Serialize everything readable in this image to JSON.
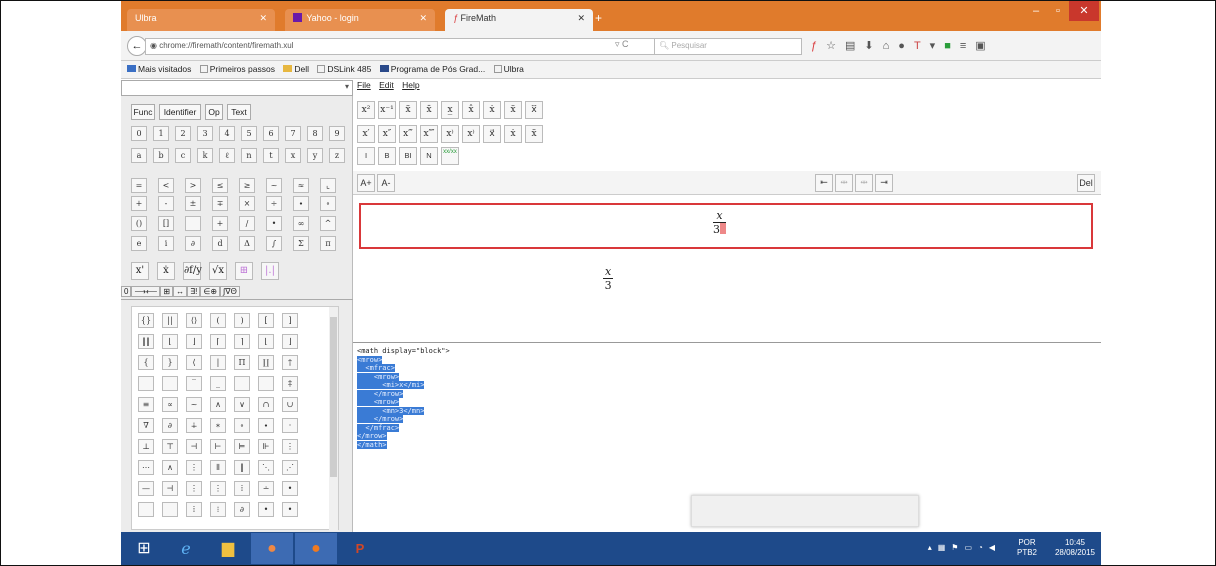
{
  "browser": {
    "tabs": [
      {
        "label": "Ulbra",
        "state": "inactive"
      },
      {
        "label": "Yahoo - login",
        "state": "inactive"
      },
      {
        "label": "FireMath",
        "state": "active"
      }
    ],
    "url": "chrome://firemath/content/firemath.xul",
    "search_placeholder": "Pesquisar",
    "bookmarks": [
      "Mais visitados",
      "Primeiros passos",
      "Dell",
      "DSLink 485",
      "Programa de Pós Grad...",
      "Ulbra"
    ],
    "accent_color": "#e07b2c"
  },
  "palette": {
    "type_buttons": [
      "Func",
      "Identifier",
      "Op",
      "Text"
    ],
    "digits": [
      "0",
      "1",
      "2",
      "3",
      "4",
      "5",
      "6",
      "7",
      "8",
      "9"
    ],
    "letters": [
      "a",
      "b",
      "c",
      "k",
      "ℓ",
      "n",
      "t",
      "x",
      "y",
      "z"
    ],
    "ops_row1": [
      "=",
      "<",
      ">",
      "≤",
      "≥",
      "~",
      "≈",
      "⌞"
    ],
    "ops_row2": [
      "+",
      "-",
      "±",
      "∓",
      "×",
      "÷",
      "∙",
      "∘"
    ],
    "ops_row3": [
      "()",
      "[]",
      "",
      "+",
      "/",
      "•",
      "∞",
      "^"
    ],
    "ops_row4": [
      "e",
      "i",
      "∂",
      "d",
      "Δ",
      "∫",
      "Σ",
      "π"
    ],
    "big_row": [
      "x'",
      "ẋ",
      "∂f/y",
      "√x",
      "⊞",
      "|.|"
    ],
    "sub_tabs": [
      "0",
      "⟶⟵",
      "⊞",
      "↔",
      "∃!",
      "∈⊕",
      "∫∇Θ"
    ],
    "symbols": [
      [
        "{}",
        "||",
        "⟨⟩",
        "(",
        ")",
        "[",
        "]"
      ],
      [
        "‖‖",
        "⌊",
        "⌋",
        "⌈",
        "⌉",
        "⌊",
        "⌋"
      ],
      [
        "{",
        "}",
        "⟨",
        "|",
        "Π",
        "∐",
        "†"
      ],
      [
        "",
        "",
        "‾",
        "_",
        "",
        "",
        "‡"
      ],
      [
        "≡",
        "∝",
        "~",
        "∧",
        "∨",
        "∩",
        "∪"
      ],
      [
        "∇",
        "∂",
        "∔",
        "∗",
        "∘",
        "∙",
        "·"
      ],
      [
        "⊥",
        "⊤",
        "⊣",
        "⊢",
        "⊨",
        "⊩",
        "⋮"
      ],
      [
        "⋯",
        "∧",
        "⋮",
        "⦀",
        "‖",
        "⋱",
        "⋰"
      ],
      [
        "—",
        "⊣",
        "⋮",
        "⋮",
        "⁞",
        "∸",
        "•"
      ],
      [
        "",
        "",
        "⁞",
        "⁝",
        "∂",
        "•",
        "•"
      ]
    ]
  },
  "menubar": {
    "file": "File",
    "edit": "Edit",
    "help": "Help"
  },
  "script_buttons": [
    "x²",
    "x⁻¹",
    "x̃",
    "x̄",
    "x̲",
    "x̂",
    "ẋ",
    "ẍ",
    "x⃛"
  ],
  "script_buttons2": [
    "x′",
    "x″",
    "x‴",
    "x⁗",
    "x⁾",
    "x⁾",
    "x⃗",
    "ẋ",
    "ẍ"
  ],
  "style_buttons": [
    "I",
    "B",
    "BI",
    "N",
    "xx/xx"
  ],
  "toolbar": {
    "font_up": "A+",
    "font_down": "A-",
    "delete": "Del"
  },
  "math": {
    "numerator": "x",
    "denominator": "3"
  },
  "mathml_code": [
    {
      "text": "<math display=\"block\">",
      "hl": false
    },
    {
      "text": "<mrow>",
      "hl": true
    },
    {
      "text": "  <mfrac>",
      "hl": true
    },
    {
      "text": "    <mrow>",
      "hl": true
    },
    {
      "text": "      <mi>x</mi>",
      "hl": true
    },
    {
      "text": "    </mrow>",
      "hl": true
    },
    {
      "text": "    <mrow>",
      "hl": true
    },
    {
      "text": "      <mn>3</mn>",
      "hl": true
    },
    {
      "text": "    </mrow>",
      "hl": true
    },
    {
      "text": "  </mfrac>",
      "hl": true
    },
    {
      "text": "</mrow>",
      "hl": true
    },
    {
      "text": "</math>",
      "hl": true
    }
  ],
  "taskbar": {
    "apps": [
      "windows-start",
      "internet-explorer",
      "file-explorer",
      "chrome",
      "firefox",
      "powerpoint"
    ],
    "language": "POR",
    "keyboard": "PTB2",
    "time": "10:45",
    "date": "28/08/2015"
  }
}
